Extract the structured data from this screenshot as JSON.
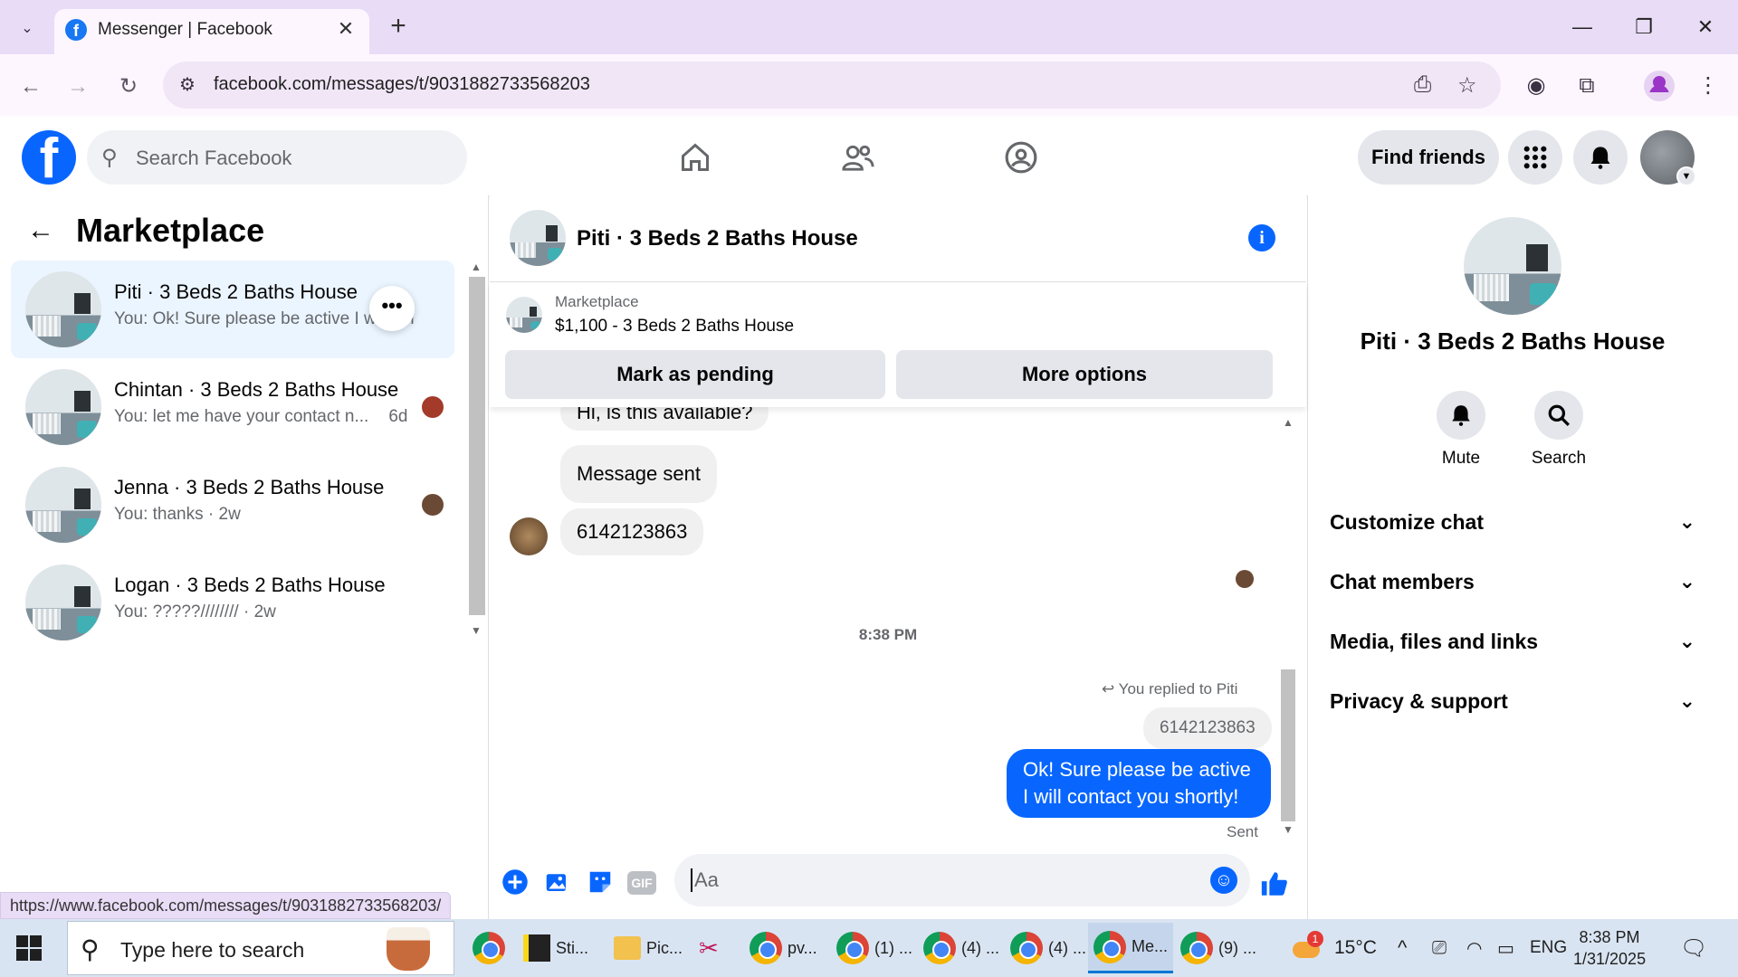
{
  "browser": {
    "tab_title": "Messenger | Facebook",
    "url": "facebook.com/messages/t/9031882733568203"
  },
  "fb": {
    "search_placeholder": "Search Facebook",
    "find_friends": "Find friends"
  },
  "left": {
    "title": "Marketplace",
    "conversations": [
      {
        "name": "Piti · 3 Beds 2 Baths House",
        "preview": "You: Ok! Sure please be active I w",
        "preview_tail": "m"
      },
      {
        "name": "Chintan · 3 Beds 2 Baths House",
        "preview": "You: let me have your contact n...",
        "time": "6d"
      },
      {
        "name": "Jenna · 3 Beds 2 Baths House",
        "preview": "You: thanks",
        "time": "2w"
      },
      {
        "name": "Logan · 3 Beds 2 Baths House",
        "preview": "You: ?????////////",
        "time": "2w"
      }
    ]
  },
  "chat": {
    "header_name": "Piti · 3 Beds 2 Baths House",
    "marketplace_label": "Marketplace",
    "listing": "$1,100 - 3 Beds 2 Baths House",
    "mark_pending": "Mark as pending",
    "more_options": "More options",
    "messages": {
      "m1": "Hi, is this available?",
      "m2": "Message sent",
      "m3": "6142123863",
      "time": "8:38 PM",
      "replied": "You replied to Piti",
      "quoted": "6142123863",
      "mine_line1": "Ok! Sure please be active",
      "mine_line2": "I will contact you shortly!",
      "sent": "Sent"
    },
    "composer_placeholder": "Aa"
  },
  "info": {
    "name": "Piti · 3 Beds 2 Baths House",
    "mute": "Mute",
    "search": "Search",
    "sections": [
      "Customize chat",
      "Chat members",
      "Media, files and links",
      "Privacy & support"
    ]
  },
  "status_url": "https://www.facebook.com/messages/t/9031882733568203/",
  "taskbar": {
    "search_text": "Type here to search",
    "apps": [
      "Sti...",
      "Pic...",
      "pv...",
      "(1) ...",
      "(4) ...",
      "(4) ...",
      "Me...",
      "(9) ..."
    ],
    "weather": "15°C",
    "lang": "ENG",
    "time": "8:38 PM",
    "date": "1/31/2025",
    "notif_count": "1"
  },
  "colors": {
    "accent": "#0866ff",
    "chrome": "#e9dcf6"
  }
}
